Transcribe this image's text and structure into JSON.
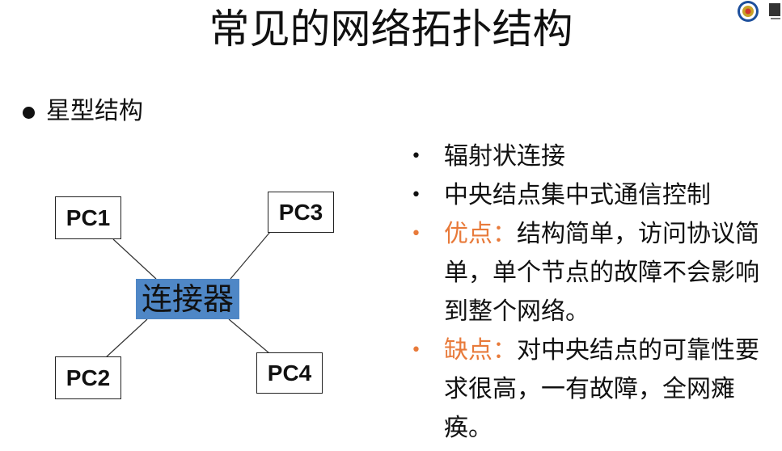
{
  "title": "常见的网络拓扑结构",
  "section": {
    "label": "星型结构"
  },
  "diagram": {
    "hub": "连接器",
    "nodes": {
      "pc1": "PC1",
      "pc2": "PC2",
      "pc3": "PC3",
      "pc4": "PC4"
    }
  },
  "bullets": [
    {
      "text": "辐射状连接"
    },
    {
      "text": "中央结点集中式通信控制"
    },
    {
      "label": "优点：",
      "text": "结构简单，访问协议简单，单个节点的故障不会影响到整个网络。"
    },
    {
      "label": "缺点：",
      "text": "对中央结点的可靠性要求很高，一有故障，全网瘫痪。"
    }
  ],
  "colors": {
    "accent": "#e87a3a",
    "hub_fill": "#4f87c6"
  },
  "icons": [
    "university-logo-icon",
    "secondary-logo-icon",
    "bullet-dot-icon"
  ]
}
